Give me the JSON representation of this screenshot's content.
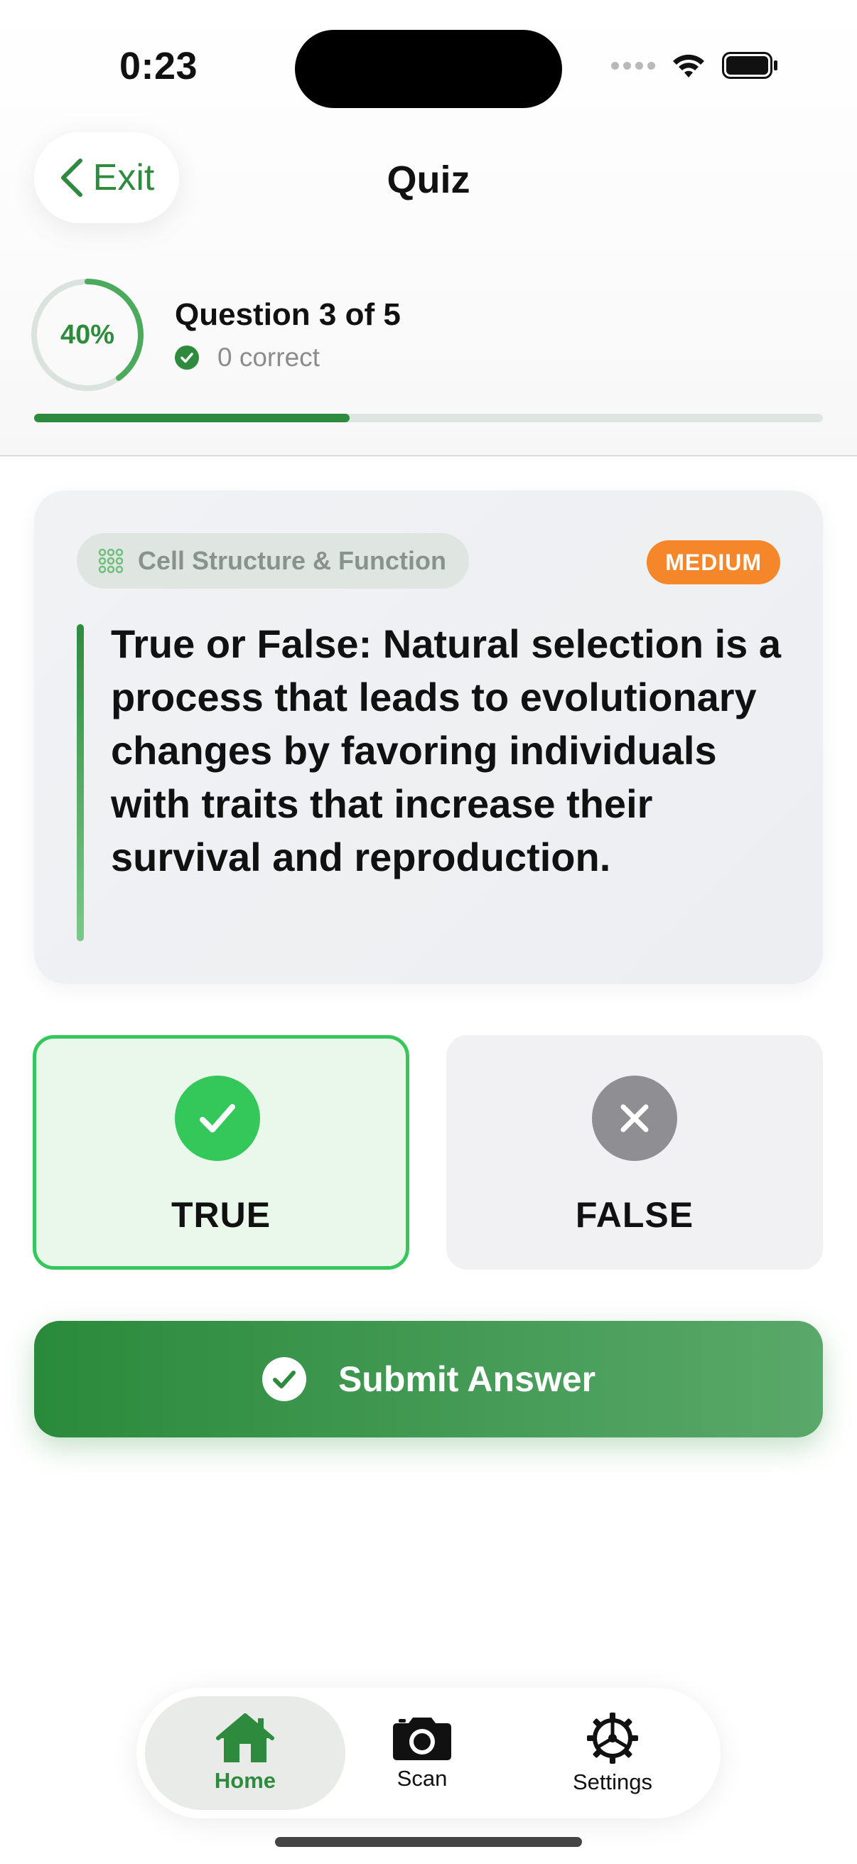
{
  "status_bar": {
    "time": "0:23"
  },
  "header": {
    "exit_label": "Exit",
    "title": "Quiz"
  },
  "progress": {
    "percent_label": "40%",
    "percent_value": 0.4,
    "question_label": "Question 3 of 5",
    "correct_label": "0 correct"
  },
  "question": {
    "topic": "Cell Structure & Function",
    "difficulty": "MEDIUM",
    "text": "True or False: Natural selection is a process that leads to evolutionary changes by favoring individuals with traits that increase their survival and reproduction."
  },
  "answers": {
    "true_label": "TRUE",
    "false_label": "FALSE",
    "selected": "TRUE"
  },
  "submit": {
    "label": "Submit Answer"
  },
  "tabbar": {
    "items": [
      {
        "label": "Home",
        "icon": "house-icon",
        "active": true
      },
      {
        "label": "Scan",
        "icon": "camera-icon",
        "active": false
      },
      {
        "label": "Settings",
        "icon": "gear-icon",
        "active": false
      }
    ]
  },
  "colors": {
    "brand_green": "#2e8b3e",
    "selected_green": "#34c759",
    "difficulty_orange": "#f5862a",
    "unselected_gray": "#8e8e93"
  }
}
